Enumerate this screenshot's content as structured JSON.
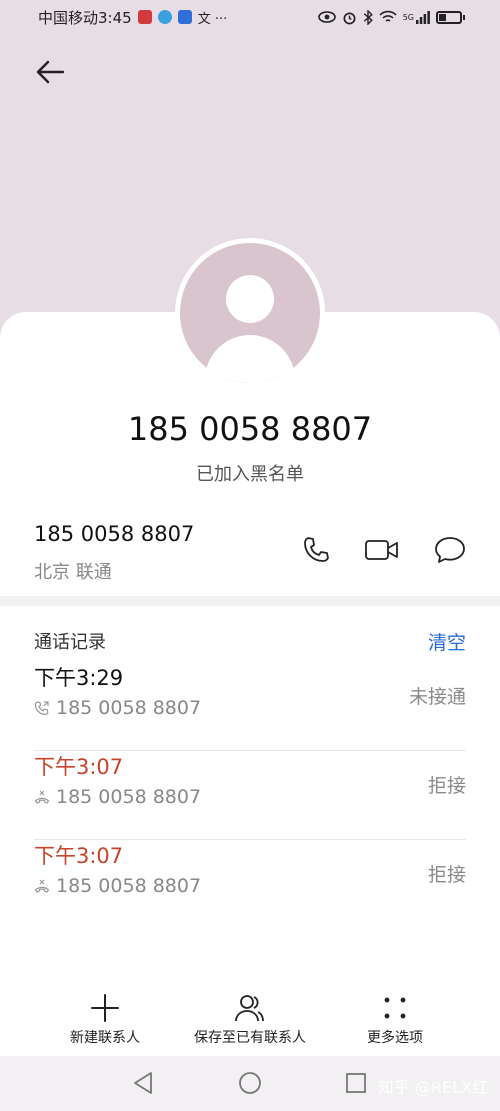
{
  "status_bar": {
    "carrier_time": "中国移动3:45",
    "extra_glyph": "文 ···",
    "signal_label": "5G"
  },
  "contact": {
    "number": "185 0058 8807",
    "status": "已加入黑名单",
    "location": "北京 联通"
  },
  "call_log": {
    "header": "通话记录",
    "clear_label": "清空",
    "rows": [
      {
        "time": "下午3:29",
        "number": "185 0058 8807",
        "status": "未接通",
        "missed": false
      },
      {
        "time": "下午3:07",
        "number": "185 0058 8807",
        "status": "拒接",
        "missed": true
      },
      {
        "time": "下午3:07",
        "number": "185 0058 8807",
        "status": "拒接",
        "missed": true
      }
    ]
  },
  "bottom_actions": {
    "new_contact": "新建联系人",
    "save_existing": "保存至已有联系人",
    "more_options": "更多选项"
  },
  "watermark": "知乎 @RELX红",
  "colors": {
    "header_bg": "#e7dde4",
    "accent": "#2a6bd1",
    "missed": "#c8432c",
    "avatar": "#d8c5cd"
  },
  "icons": [
    "back-arrow-icon",
    "phone-icon",
    "video-call-icon",
    "message-icon",
    "add-icon",
    "person-icon",
    "more-dots-icon"
  ]
}
